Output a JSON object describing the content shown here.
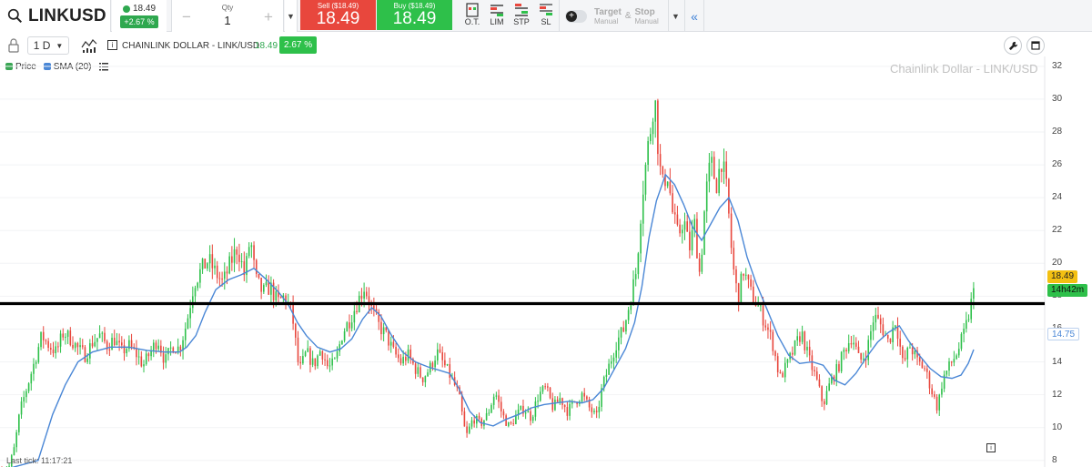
{
  "toolbar": {
    "symbol": "LINKUSD",
    "quote_price": "18.49",
    "quote_change": "+2.67 %",
    "qty_label": "Qty",
    "qty_value": "1",
    "sell_label": "Sell ($18.49)",
    "sell_price": "18.49",
    "buy_label": "Buy ($18.49)",
    "buy_price": "18.49",
    "order_types": [
      "O.T.",
      "LIM",
      "STP",
      "SL"
    ],
    "target_label": "Target",
    "target_mode": "Manual",
    "stop_label": "Stop",
    "stop_mode": "Manual",
    "amp": "&"
  },
  "chart_header": {
    "interval": "1 D",
    "instrument": "CHAINLINK DOLLAR - LINK/USD",
    "price": "18.49",
    "change": "2.67 %"
  },
  "legend": [
    {
      "label": "Price",
      "color": "#3aa655"
    },
    {
      "label": "SMA (20)",
      "color": "#4a87d6"
    }
  ],
  "watermark": "Chainlink Dollar - LINK/USD",
  "price_tags": {
    "last": "18.49",
    "timer": "14h42m",
    "sma": "14.75"
  },
  "last_tick": "Last tick: 11:17:21",
  "colors": {
    "up": "#2ec04a",
    "down": "#e8473d",
    "sma": "#4a87d6",
    "hline": "#000000"
  },
  "chart_data": {
    "type": "candlestick",
    "y_axis_ticks": [
      8,
      10,
      12,
      14,
      16,
      18,
      20,
      22,
      24,
      26,
      28,
      30,
      32
    ],
    "ylim": [
      7.6,
      32.6
    ],
    "horizontal_line": 17.55,
    "close_path": [
      [
        0,
        7.4
      ],
      [
        8,
        7.6
      ],
      [
        14,
        8.8
      ],
      [
        20,
        11.0
      ],
      [
        28,
        12.5
      ],
      [
        36,
        14.0
      ],
      [
        44,
        15.6
      ],
      [
        52,
        15.0
      ],
      [
        60,
        14.6
      ],
      [
        68,
        15.8
      ],
      [
        76,
        15.4
      ],
      [
        84,
        14.8
      ],
      [
        92,
        14.4
      ],
      [
        100,
        15.2
      ],
      [
        108,
        15.6
      ],
      [
        116,
        15.0
      ],
      [
        124,
        15.4
      ],
      [
        132,
        14.6
      ],
      [
        140,
        15.0
      ],
      [
        148,
        14.5
      ],
      [
        156,
        13.8
      ],
      [
        164,
        14.6
      ],
      [
        172,
        15.4
      ],
      [
        180,
        14.0
      ],
      [
        188,
        15.0
      ],
      [
        196,
        14.8
      ],
      [
        204,
        16.4
      ],
      [
        212,
        18.8
      ],
      [
        220,
        19.6
      ],
      [
        228,
        20.2
      ],
      [
        236,
        19.4
      ],
      [
        244,
        18.8
      ],
      [
        252,
        20.0
      ],
      [
        260,
        21.0
      ],
      [
        268,
        19.2
      ],
      [
        274,
        21.6
      ],
      [
        280,
        19.0
      ],
      [
        288,
        18.2
      ],
      [
        296,
        18.6
      ],
      [
        304,
        17.6
      ],
      [
        312,
        18.0
      ],
      [
        320,
        17.0
      ],
      [
        328,
        13.4
      ],
      [
        336,
        14.6
      ],
      [
        344,
        13.8
      ],
      [
        352,
        14.8
      ],
      [
        360,
        13.6
      ],
      [
        368,
        14.0
      ],
      [
        376,
        15.8
      ],
      [
        384,
        16.6
      ],
      [
        392,
        17.6
      ],
      [
        400,
        18.6
      ],
      [
        408,
        17.2
      ],
      [
        416,
        16.2
      ],
      [
        424,
        15.6
      ],
      [
        432,
        14.6
      ],
      [
        440,
        14.0
      ],
      [
        448,
        14.4
      ],
      [
        456,
        13.6
      ],
      [
        464,
        13.0
      ],
      [
        472,
        13.6
      ],
      [
        480,
        14.6
      ],
      [
        488,
        13.8
      ],
      [
        496,
        13.0
      ],
      [
        504,
        12.0
      ],
      [
        512,
        9.4
      ],
      [
        520,
        10.6
      ],
      [
        528,
        10.2
      ],
      [
        536,
        10.8
      ],
      [
        544,
        12.2
      ],
      [
        552,
        10.8
      ],
      [
        560,
        10.0
      ],
      [
        568,
        10.8
      ],
      [
        576,
        11.2
      ],
      [
        584,
        10.6
      ],
      [
        592,
        12.0
      ],
      [
        600,
        12.4
      ],
      [
        608,
        11.2
      ],
      [
        616,
        11.8
      ],
      [
        624,
        11.0
      ],
      [
        632,
        11.6
      ],
      [
        640,
        12.0
      ],
      [
        648,
        11.2
      ],
      [
        656,
        10.6
      ],
      [
        662,
        12.4
      ],
      [
        670,
        13.8
      ],
      [
        678,
        15.2
      ],
      [
        686,
        16.0
      ],
      [
        694,
        18.0
      ],
      [
        700,
        19.6
      ],
      [
        706,
        24.0
      ],
      [
        712,
        26.8
      ],
      [
        716,
        28.4
      ],
      [
        720,
        30.4
      ],
      [
        724,
        27.0
      ],
      [
        728,
        24.6
      ],
      [
        734,
        25.6
      ],
      [
        740,
        23.0
      ],
      [
        746,
        21.6
      ],
      [
        752,
        22.8
      ],
      [
        758,
        20.8
      ],
      [
        764,
        22.4
      ],
      [
        770,
        19.2
      ],
      [
        776,
        24.0
      ],
      [
        782,
        26.2
      ],
      [
        788,
        24.8
      ],
      [
        794,
        26.4
      ],
      [
        800,
        24.2
      ],
      [
        806,
        20.0
      ],
      [
        812,
        17.8
      ],
      [
        818,
        19.6
      ],
      [
        826,
        18.2
      ],
      [
        834,
        17.4
      ],
      [
        842,
        16.4
      ],
      [
        850,
        15.2
      ],
      [
        858,
        13.0
      ],
      [
        866,
        13.8
      ],
      [
        874,
        14.8
      ],
      [
        882,
        15.8
      ],
      [
        890,
        14.2
      ],
      [
        898,
        13.0
      ],
      [
        906,
        11.4
      ],
      [
        914,
        12.8
      ],
      [
        922,
        13.6
      ],
      [
        930,
        14.8
      ],
      [
        938,
        15.6
      ],
      [
        946,
        14.0
      ],
      [
        954,
        14.6
      ],
      [
        962,
        16.8
      ],
      [
        970,
        16.2
      ],
      [
        978,
        15.2
      ],
      [
        986,
        16.6
      ],
      [
        994,
        13.8
      ],
      [
        1002,
        15.0
      ],
      [
        1010,
        14.0
      ],
      [
        1018,
        13.6
      ],
      [
        1026,
        12.2
      ],
      [
        1032,
        11.2
      ],
      [
        1038,
        13.0
      ],
      [
        1046,
        13.8
      ],
      [
        1054,
        14.6
      ],
      [
        1062,
        15.8
      ],
      [
        1068,
        17.2
      ],
      [
        1072,
        18.49
      ]
    ],
    "sma_path": [
      [
        0,
        7.4
      ],
      [
        40,
        8.0
      ],
      [
        56,
        10.8
      ],
      [
        70,
        12.6
      ],
      [
        84,
        14.0
      ],
      [
        100,
        14.6
      ],
      [
        120,
        14.9
      ],
      [
        140,
        14.9
      ],
      [
        160,
        14.7
      ],
      [
        180,
        14.6
      ],
      [
        196,
        14.6
      ],
      [
        204,
        14.9
      ],
      [
        214,
        15.6
      ],
      [
        224,
        17.0
      ],
      [
        236,
        18.4
      ],
      [
        250,
        19.0
      ],
      [
        264,
        19.3
      ],
      [
        278,
        19.7
      ],
      [
        292,
        19.0
      ],
      [
        306,
        18.2
      ],
      [
        316,
        17.5
      ],
      [
        326,
        16.4
      ],
      [
        336,
        15.6
      ],
      [
        348,
        14.9
      ],
      [
        362,
        14.6
      ],
      [
        374,
        14.8
      ],
      [
        386,
        15.4
      ],
      [
        398,
        16.6
      ],
      [
        408,
        17.3
      ],
      [
        418,
        16.8
      ],
      [
        430,
        15.6
      ],
      [
        442,
        14.6
      ],
      [
        456,
        14.0
      ],
      [
        470,
        13.7
      ],
      [
        482,
        13.5
      ],
      [
        494,
        13.3
      ],
      [
        504,
        12.4
      ],
      [
        516,
        11.0
      ],
      [
        528,
        10.3
      ],
      [
        542,
        10.1
      ],
      [
        556,
        10.5
      ],
      [
        570,
        10.8
      ],
      [
        584,
        11.2
      ],
      [
        598,
        11.4
      ],
      [
        612,
        11.5
      ],
      [
        626,
        11.6
      ],
      [
        640,
        11.5
      ],
      [
        652,
        11.7
      ],
      [
        664,
        12.4
      ],
      [
        676,
        13.6
      ],
      [
        688,
        14.8
      ],
      [
        698,
        16.4
      ],
      [
        706,
        18.6
      ],
      [
        714,
        21.6
      ],
      [
        722,
        23.8
      ],
      [
        732,
        25.4
      ],
      [
        742,
        24.8
      ],
      [
        752,
        23.6
      ],
      [
        762,
        22.2
      ],
      [
        772,
        21.4
      ],
      [
        782,
        22.4
      ],
      [
        792,
        23.4
      ],
      [
        802,
        24.0
      ],
      [
        812,
        22.6
      ],
      [
        822,
        20.4
      ],
      [
        832,
        18.8
      ],
      [
        844,
        17.2
      ],
      [
        856,
        15.6
      ],
      [
        868,
        14.4
      ],
      [
        880,
        13.9
      ],
      [
        894,
        14.0
      ],
      [
        906,
        13.8
      ],
      [
        918,
        12.9
      ],
      [
        930,
        12.6
      ],
      [
        942,
        13.3
      ],
      [
        954,
        14.3
      ],
      [
        966,
        15.2
      ],
      [
        978,
        15.8
      ],
      [
        990,
        16.2
      ],
      [
        1000,
        15.3
      ],
      [
        1012,
        14.4
      ],
      [
        1024,
        13.6
      ],
      [
        1036,
        13.1
      ],
      [
        1048,
        13.0
      ],
      [
        1058,
        13.2
      ],
      [
        1066,
        13.9
      ],
      [
        1072,
        14.75
      ]
    ]
  }
}
